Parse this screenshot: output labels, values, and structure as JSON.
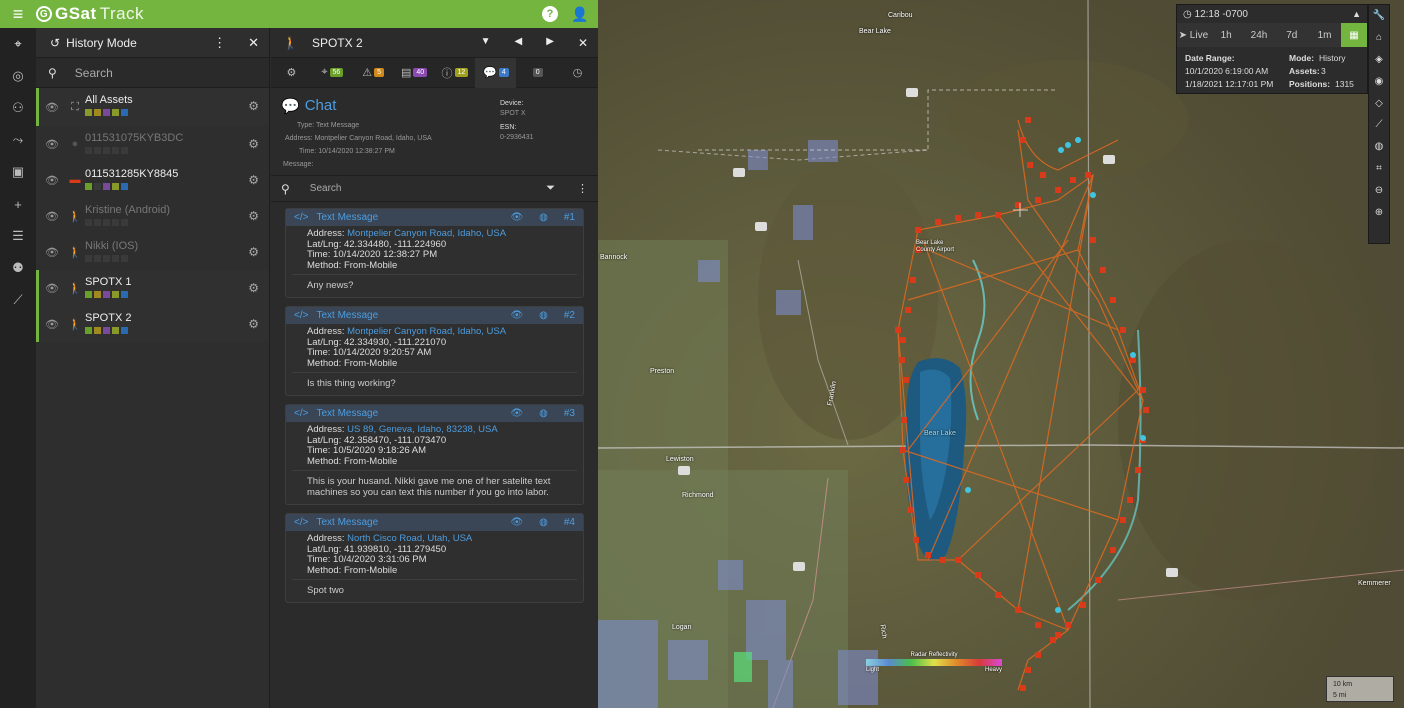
{
  "app": {
    "logo_text": "GSat",
    "logo_text2": "Track",
    "help_icon": "question-circle",
    "user_icon": "user"
  },
  "rail": {
    "icons": [
      "map-pin-icon",
      "target-icon",
      "network-icon",
      "route-icon",
      "box-icon",
      "plus-icon",
      "list-icon",
      "users-icon",
      "chart-icon"
    ]
  },
  "assets_panel": {
    "title": "History Mode",
    "search_placeholder": "Search",
    "items": [
      {
        "name": "All Assets",
        "badge": "6",
        "dim": false,
        "selected": true,
        "colors": [
          "#8a9a2a",
          "#a08a20",
          "#7a4a9a",
          "#8a9a2a",
          "#2a6ab0"
        ]
      },
      {
        "name": "011531075KYB3DC",
        "dim": true,
        "selected": false,
        "colors": [
          "#3a3a3a",
          "#3a3a3a",
          "#3a3a3a",
          "#3a3a3a",
          "#3a3a3a"
        ]
      },
      {
        "name": "011531285KY8845",
        "dim": false,
        "selected": false,
        "colors": [
          "#6aa02a",
          "#3a3a3a",
          "#7a4a9a",
          "#8a9a2a",
          "#2a6ab0"
        ]
      },
      {
        "name": "Kristine (Android)",
        "dim": true,
        "selected": false,
        "colors": []
      },
      {
        "name": "Nikki (IOS)",
        "dim": true,
        "selected": false,
        "colors": []
      },
      {
        "name": "SPOTX 1",
        "dim": false,
        "selected": true,
        "colors": [
          "#6aa02a",
          "#a08a20",
          "#7a4a9a",
          "#8a9a2a",
          "#2a6ab0"
        ]
      },
      {
        "name": "SPOTX 2",
        "dim": false,
        "selected": true,
        "colors": [
          "#6aa02a",
          "#a08a20",
          "#7a4a9a",
          "#8a9a2a",
          "#2a6ab0"
        ]
      }
    ]
  },
  "detail": {
    "title": "SPOTX 2",
    "tabs": [
      {
        "icon": "settings-icon",
        "badge": ""
      },
      {
        "icon": "location-icon",
        "badge": "56",
        "color": "#6aa02a"
      },
      {
        "icon": "alert-icon",
        "badge": "5",
        "color": "#d08a1a"
      },
      {
        "icon": "document-icon",
        "badge": "40",
        "color": "#8a4ab0"
      },
      {
        "icon": "info-icon",
        "badge": "12",
        "color": "#a0a020"
      },
      {
        "icon": "chat-icon",
        "badge": "4",
        "color": "#3a7ac8",
        "active": true
      },
      {
        "icon": "code-icon",
        "badge": "0",
        "color": "#555"
      },
      {
        "icon": "clock-icon",
        "badge": ""
      }
    ],
    "chat": {
      "title": "Chat",
      "type_label": "Type:",
      "type_value": "Text Message",
      "address_label": "Address:",
      "address_value": "Montpelier Canyon Road, Idaho, USA",
      "time_label": "Time:",
      "time_value": "10/14/2020 12:38:27 PM",
      "message_label": "Message:",
      "device_label": "Device:",
      "device_value": "SPOT X",
      "esn_label": "ESN:",
      "esn_value": "0-2936431"
    },
    "search_placeholder": "Search",
    "messages": [
      {
        "label": "Text Message",
        "num": "#1",
        "address": "Montpelier Canyon Road, Idaho, USA",
        "latlng": "42.334480, -111.224960",
        "time": "10/14/2020 12:38:27 PM",
        "method": "From-Mobile",
        "text": "Any news?"
      },
      {
        "label": "Text Message",
        "num": "#2",
        "address": "Montpelier Canyon Road, Idaho, USA",
        "latlng": "42.334930, -111.221070",
        "time": "10/14/2020 9:20:57 AM",
        "method": "From-Mobile",
        "text": "Is this thing working?"
      },
      {
        "label": "Text Message",
        "num": "#3",
        "address": "US 89, Geneva, Idaho, 83238, USA",
        "latlng": "42.358470, -111.073470",
        "time": "10/5/2020 9:18:26 AM",
        "method": "From-Mobile",
        "text": "This is your husand. Nikki gave me one of her satelite text machines so you can text this number if you go into labor."
      },
      {
        "label": "Text Message",
        "num": "#4",
        "address": "North Cisco Road, Utah, USA",
        "latlng": "41.939810, -111.279450",
        "time": "10/4/2020 3:31:06 PM",
        "method": "From-Mobile",
        "text": "Spot two"
      }
    ],
    "field_labels": {
      "address": "Address:",
      "latlng": "Lat/Lng:",
      "time": "Time:",
      "method": "Method:"
    }
  },
  "map": {
    "labels": [
      "Caribou",
      "Bear Lake",
      "Bannock",
      "Preston",
      "Lewiston",
      "Richmond",
      "Logan",
      "Franklin",
      "Rich",
      "Bear Lake",
      "Kemmerer",
      "Bear Lake County Airport"
    ],
    "timebox": {
      "time": "12:18 -0700",
      "buttons": [
        "Live",
        "1h",
        "24h",
        "7d",
        "1m"
      ],
      "date_range_label": "Date Range:",
      "date_from": "10/1/2020 6:19:00 AM",
      "date_to": "1/18/2021 12:17:01 PM",
      "mode_label": "Mode:",
      "mode_value": "History",
      "assets_label": "Assets:",
      "assets_value": "3",
      "positions_label": "Positions:",
      "positions_value": "1315"
    },
    "tools": [
      "wrench-icon",
      "building-icon",
      "layers-icon",
      "compass-icon",
      "waypoint-icon",
      "ruler-icon",
      "globe-icon",
      "crop-icon",
      "zoom-out-icon",
      "zoom-in-icon"
    ],
    "legend": {
      "title": "Radar Reflectivity",
      "low": "Light",
      "high": "Heavy"
    },
    "scale": {
      "km": "10 km",
      "mi": "5 mi"
    }
  }
}
